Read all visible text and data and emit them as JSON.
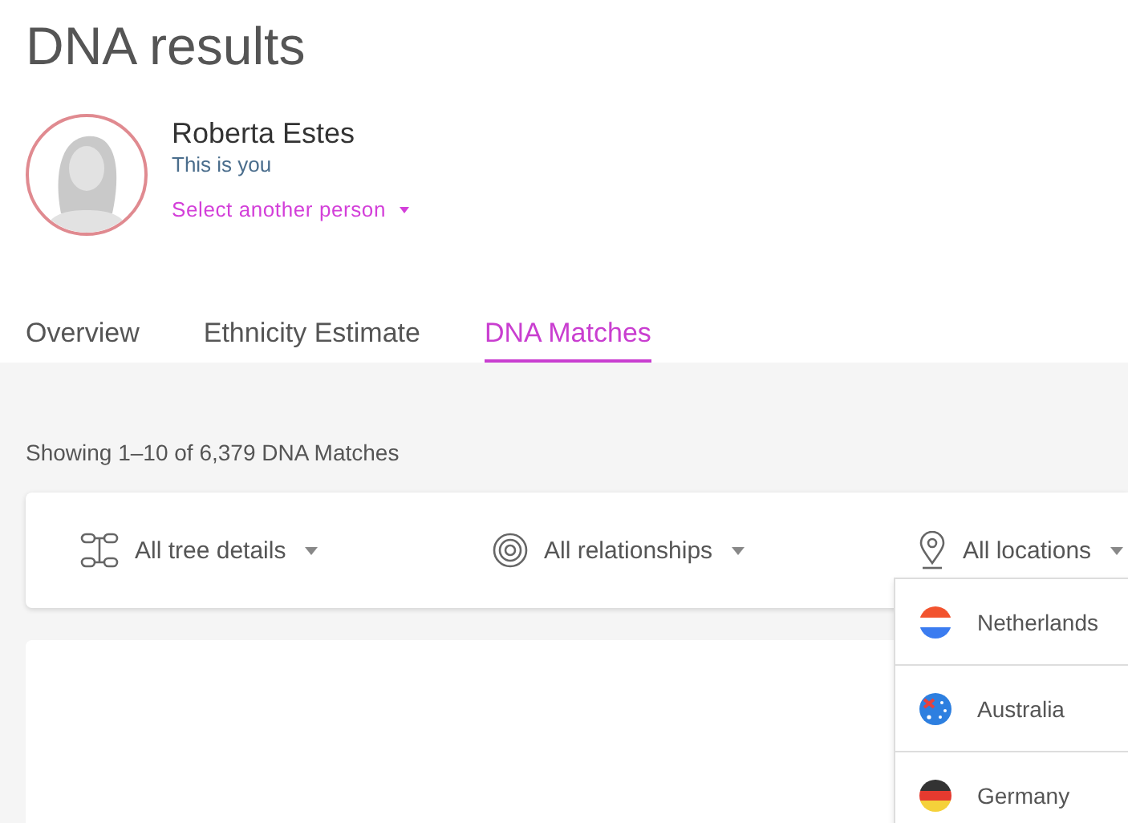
{
  "page": {
    "title": "DNA results"
  },
  "person": {
    "name": "Roberta Estes",
    "subtitle": "This is you",
    "switch_link": "Select another person"
  },
  "tabs": [
    {
      "label": "Overview",
      "selected": false
    },
    {
      "label": "Ethnicity Estimate",
      "selected": false
    },
    {
      "label": "DNA Matches",
      "selected": true
    }
  ],
  "summary": "Showing 1–10 of 6,379 DNA Matches",
  "filters": [
    {
      "kind": "tree",
      "label": "All tree details"
    },
    {
      "kind": "relationship",
      "label": "All relationships"
    },
    {
      "kind": "location",
      "label": "All locations"
    }
  ],
  "location_menu": [
    {
      "kind": "nl",
      "label": "Netherlands"
    },
    {
      "kind": "au",
      "label": "Australia"
    },
    {
      "kind": "de",
      "label": "Germany"
    }
  ]
}
